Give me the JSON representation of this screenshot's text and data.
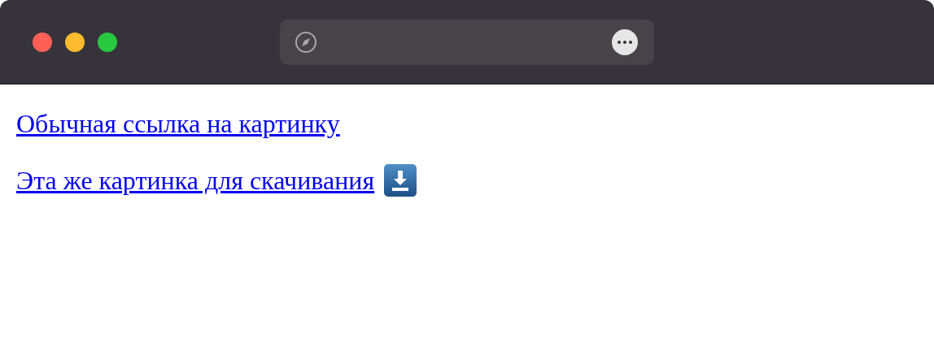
{
  "links": [
    {
      "text": "Обычная ссылка на картинку",
      "kind": "plain"
    },
    {
      "text": "Эта же картинка для скачивания",
      "kind": "download"
    }
  ]
}
